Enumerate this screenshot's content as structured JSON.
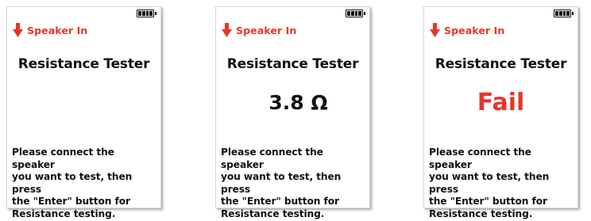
{
  "accent_color": "#e8352a",
  "screens": [
    {
      "battery_icon": "battery-full-icon",
      "header_icon": "arrow-down-icon",
      "header_label": "Speaker In",
      "title": "Resistance Tester",
      "reading": "",
      "instructions": "Please connect the speaker\nyou want to test, then press\nthe \"Enter\" button for\nResistance testing."
    },
    {
      "battery_icon": "battery-full-icon",
      "header_icon": "arrow-down-icon",
      "header_label": "Speaker In",
      "title": "Resistance Tester",
      "reading": "3.8 Ω",
      "instructions": "Please connect the speaker\nyou want to test, then press\nthe \"Enter\" button for\nResistance testing."
    },
    {
      "battery_icon": "battery-full-icon",
      "header_icon": "arrow-down-icon",
      "header_label": "Speaker In",
      "title": "Resistance Tester",
      "reading": "Fail",
      "instructions": "Please connect the speaker\nyou want to test, then press\nthe \"Enter\" button for\nResistance testing."
    }
  ]
}
